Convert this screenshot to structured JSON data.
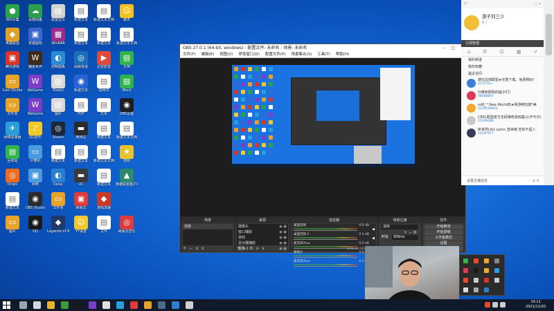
{
  "desktop_icons": [
    {
      "label": "360大集",
      "color": "#2aa24a",
      "glyph": "●"
    },
    {
      "label": "百度网盘",
      "color": "#2a9e4d",
      "glyph": "☁"
    },
    {
      "label": "联盟宝贝",
      "color": "#d3d3d3",
      "glyph": "▤"
    },
    {
      "label": "新建文本",
      "color": "#ffffff",
      "glyph": "▤"
    },
    {
      "label": "新建文本文档",
      "color": "#ffffff",
      "glyph": "▤"
    },
    {
      "label": "聊天",
      "color": "#f5c31e",
      "glyph": "☺"
    },
    {
      "label": "英雄联盟",
      "color": "#e0a12a",
      "glyph": "◆"
    },
    {
      "label": "安装图标",
      "color": "#3a66d0",
      "glyph": "▣"
    },
    {
      "label": "WinRAR",
      "color": "#9b2c8f",
      "glyph": "▦"
    },
    {
      "label": "新建文本",
      "color": "#ffffff",
      "glyph": "▤"
    },
    {
      "label": "新建文本",
      "color": "#ffffff",
      "glyph": "▤"
    },
    {
      "label": "新建文本文档",
      "color": "#ffffff",
      "glyph": "▤"
    },
    {
      "label": "腾讯游戏",
      "color": "#d8352a",
      "glyph": "▣"
    },
    {
      "label": "魔兽世界",
      "color": "#3e2a18",
      "glyph": "W"
    },
    {
      "label": "控制面板",
      "color": "#2a8ad6",
      "glyph": "◐"
    },
    {
      "label": "网易有道",
      "color": "#1a6fb8",
      "glyph": "◎"
    },
    {
      "label": "迅雷影音",
      "color": "#e04a3a",
      "glyph": "▶"
    },
    {
      "label": "文档",
      "color": "#2fb34a",
      "glyph": "▤"
    },
    {
      "label": "Cam Studio",
      "color": "#e8a42a",
      "glyph": "▭"
    },
    {
      "label": "WeGame",
      "color": "#7a3ec8",
      "glyph": "W"
    },
    {
      "label": "Steam",
      "color": "#d9d9d9",
      "glyph": "▤"
    },
    {
      "label": "新建文本",
      "color": "#2a64d4",
      "glyph": "◉"
    },
    {
      "label": "说明书",
      "color": "#ffffff",
      "glyph": "▤"
    },
    {
      "label": "Word",
      "color": "#2fb34a",
      "glyph": "▤"
    },
    {
      "label": "文件夹",
      "color": "#e8a42a",
      "glyph": "▭"
    },
    {
      "label": "WeGame",
      "color": "#7a3ec8",
      "glyph": "W"
    },
    {
      "label": "图片",
      "color": "#d9d9d9",
      "glyph": "▤"
    },
    {
      "label": "PDF",
      "color": "#ffffff",
      "glyph": "▤"
    },
    {
      "label": "文本",
      "color": "#ffffff",
      "glyph": "▤"
    },
    {
      "label": "OBS设置",
      "color": "#1e1e1e",
      "glyph": "◉"
    },
    {
      "label": "网络加速器",
      "color": "#2a9ed8",
      "glyph": "✈"
    },
    {
      "label": "QQ音乐",
      "color": "#f2c82a",
      "glyph": "♪"
    },
    {
      "label": "Steam",
      "color": "#1b2838",
      "glyph": "◎"
    },
    {
      "label": "英伟达",
      "color": "#2b2b2b",
      "glyph": "▬"
    },
    {
      "label": "新建文本",
      "color": "#ffffff",
      "glyph": "▤"
    },
    {
      "label": "新建文本文档",
      "color": "#ffffff",
      "glyph": "▤"
    },
    {
      "label": "回收站",
      "color": "#2fb34a",
      "glyph": "▤"
    },
    {
      "label": "计算机",
      "color": "#4a9ae0",
      "glyph": "▭"
    },
    {
      "label": "新建文本",
      "color": "#ffffff",
      "glyph": "▤"
    },
    {
      "label": "新建文本",
      "color": "#ffffff",
      "glyph": "▤"
    },
    {
      "label": "新建文本文档",
      "color": "#ffffff",
      "glyph": "▤"
    },
    {
      "label": "游戏",
      "color": "#e8c42a",
      "glyph": "★"
    },
    {
      "label": "Origin",
      "color": "#f26a1b",
      "glyph": "◎"
    },
    {
      "label": "网络",
      "color": "#4a9ae0",
      "glyph": "▣"
    },
    {
      "label": "Uplay",
      "color": "#2a80d0",
      "glyph": "◐"
    },
    {
      "label": "UC",
      "color": "#3a3a3a",
      "glyph": "▬"
    },
    {
      "label": "新建文本",
      "color": "#ffffff",
      "glyph": "▤"
    },
    {
      "label": "英雄联盟客户端",
      "color": "#2a8a6a",
      "glyph": "▲"
    },
    {
      "label": "新建文本",
      "color": "#ffffff",
      "glyph": "▤"
    },
    {
      "label": "OBS Studio",
      "color": "#2b2b2b",
      "glyph": "◉"
    },
    {
      "label": "文件夹",
      "color": "#e8a42a",
      "glyph": "▭"
    },
    {
      "label": "网易云",
      "color": "#e03a3a",
      "glyph": "▣"
    },
    {
      "label": "游戏加速",
      "color": "#c83a2a",
      "glyph": "◆"
    },
    {
      "label": "",
      "color": "",
      "glyph": ""
    },
    {
      "label": "图片",
      "color": "#e8a42a",
      "glyph": "▭"
    },
    {
      "label": "QQ",
      "color": "#1a1a1a",
      "glyph": "◉"
    },
    {
      "label": "Legends of Runeterra",
      "color": "#1e3a6a",
      "glyph": "◆"
    },
    {
      "label": "YY语音",
      "color": "#f2c82a",
      "glyph": "☺"
    },
    {
      "label": "文件",
      "color": "#ffffff",
      "glyph": "▤"
    },
    {
      "label": "网易云音乐",
      "color": "#e03a3a",
      "glyph": "◎"
    }
  ],
  "obs": {
    "title": "OBS 27.0.1 (64-bit, windows) - 配置文件: 未命名 - 场景: 未命名",
    "menu": [
      "文件(F)",
      "编辑(E)",
      "视图(V)",
      "停靠窗口(D)",
      "配置文件(P)",
      "场景集合(S)",
      "工具(T)",
      "帮助(H)"
    ],
    "docks": {
      "scenes": {
        "title": "场景",
        "items": [
          "场景"
        ]
      },
      "sources": {
        "title": "来源",
        "items": [
          "摄像头",
          "窗口捕获",
          "游戏",
          "显示器捕获",
          "图像 1"
        ]
      },
      "mixer": {
        "title": "混音器",
        "channels": [
          {
            "name": "桌面音频",
            "value": "0.0 dB"
          },
          {
            "name": "桌面音频 2",
            "value": "0.0 dB"
          },
          {
            "name": "麦克风/Aux",
            "value": "0.0 dB"
          },
          {
            "name": "摄像头",
            "value": "0.0 dB"
          },
          {
            "name": "麦克风/Aux",
            "value": "0.0 dB"
          }
        ]
      },
      "transitions": {
        "title": "场景过渡",
        "type": "淡出",
        "duration_label": "时长",
        "duration": "300ms"
      },
      "controls": {
        "title": "控件",
        "buttons": [
          "开始推流",
          "开始录制",
          "工作室模式",
          "设置",
          "退出"
        ]
      }
    },
    "status": "1216  00:00:00"
  },
  "chat_panel": {
    "username": "游子刘三少",
    "sub": "8 ♪",
    "banner": "订阅管理",
    "menu": [
      "我的频道",
      "我的收藏",
      "最近访问"
    ],
    "feed": [
      {
        "title": "德玛总部联盟★无限下载、免费畅玩!",
        "count": "2375.5k+",
        "color": "#3a7fd8"
      },
      {
        "title": "刘某和刚刚的面子们!",
        "count": "48488847",
        "color": "#e03a5a"
      },
      {
        "title": "nd8_* New World高★网游畅玩度*美",
        "count": "2314108603",
        "color": "#f2a82a"
      },
      {
        "title": "CEKL联盟官方全民推荐游戏集(公开今日)",
        "count": "27409086",
        "color": "#c8c8c8"
      },
      {
        "title": "新世界LKG Lemo 直钟被 范抓不留人",
        "count": "14197977",
        "color": "#3a3a5a"
      }
    ],
    "footer": "设置主播信息"
  },
  "taskbar": {
    "time": "14:11",
    "date": "2021/11/20",
    "apps": [
      {
        "name": "search-icon",
        "color": "#9aa7b0"
      },
      {
        "name": "task-view-icon",
        "color": "#cfd8e3"
      },
      {
        "name": "file-explorer-icon",
        "color": "#e8b42a"
      },
      {
        "name": "chrome-icon",
        "color": "#3a9a3a"
      },
      {
        "name": "qq-icon",
        "color": "#1a1a1a"
      },
      {
        "name": "wegame-icon",
        "color": "#7a3ec8"
      },
      {
        "name": "obs-icon",
        "color": "#e0e0e0"
      },
      {
        "name": "edge-icon",
        "color": "#2a9ed8"
      },
      {
        "name": "netease-icon",
        "color": "#e03a3a"
      },
      {
        "name": "game-icon",
        "color": "#e8a42a"
      },
      {
        "name": "steam-icon",
        "color": "#4a6a8a"
      },
      {
        "name": "media-icon",
        "color": "#2a80d0"
      },
      {
        "name": "music-icon",
        "color": "#d0d0d0"
      }
    ]
  }
}
